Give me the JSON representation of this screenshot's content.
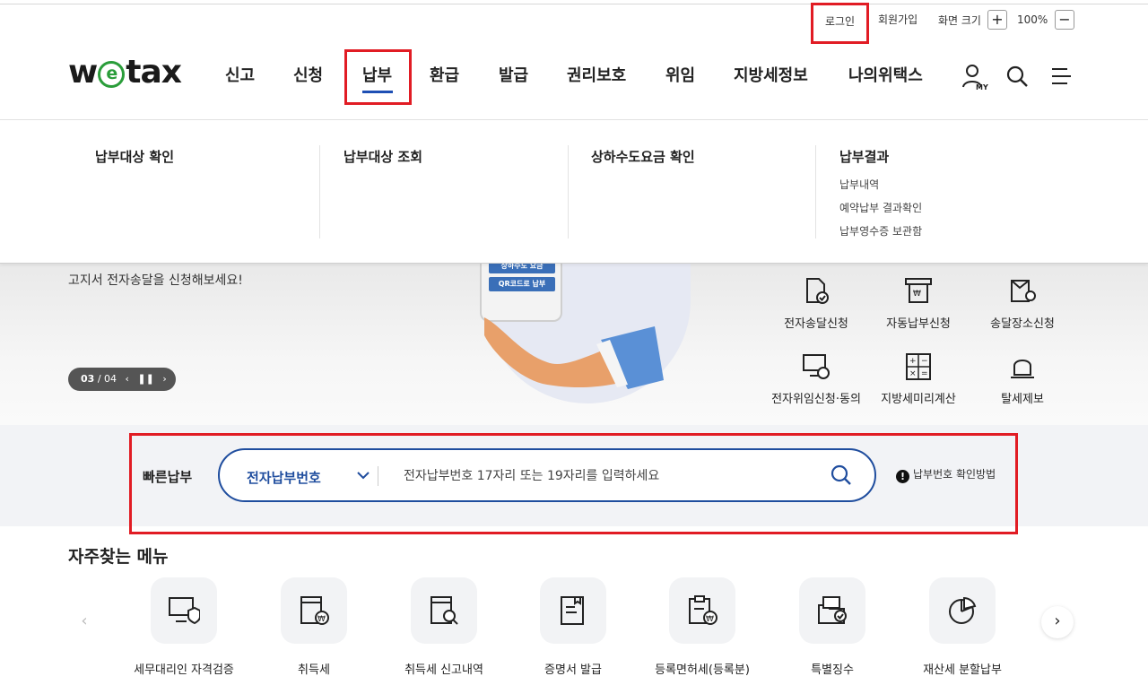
{
  "utility": {
    "login": "로그인",
    "join": "회원가입",
    "zoom_label": "화면 크기",
    "zoom_in": "+",
    "zoom_value": "100%",
    "zoom_out": "−"
  },
  "logo": {
    "w": "w",
    "e": "e",
    "tax": "tax"
  },
  "nav": {
    "items": [
      "신고",
      "신청",
      "납부",
      "환급",
      "발급",
      "권리보호",
      "위임",
      "지방세정보",
      "나의위택스"
    ],
    "active": "납부",
    "my_label": "MY"
  },
  "mega": {
    "cols": [
      {
        "title": "납부대상 확인",
        "links": []
      },
      {
        "title": "납부대상 조회",
        "links": []
      },
      {
        "title": "상하수도요금 확인",
        "links": []
      },
      {
        "title": "납부결과",
        "links": [
          "납부내역",
          "예약납부 결과확인",
          "납부영수증 보관함"
        ]
      }
    ]
  },
  "banner": {
    "copy": "고지서 전자송달을 신청해보세요!",
    "pager_current": "03",
    "pager_total": "/ 04",
    "phone_buttons": [
      "상하수도 요금",
      "QR코드로 납부"
    ]
  },
  "quick": [
    {
      "label": "전자송달신청",
      "icon": "document-check-icon"
    },
    {
      "label": "자동납부신청",
      "icon": "auto-payment-icon"
    },
    {
      "label": "송달장소신청",
      "icon": "location-document-icon"
    },
    {
      "label": "전자위임신청·동의",
      "icon": "monitor-lock-icon"
    },
    {
      "label": "지방세미리계산",
      "icon": "calculator-icon"
    },
    {
      "label": "탈세제보",
      "icon": "siren-icon"
    }
  ],
  "fast_pay": {
    "title": "빠른납부",
    "select_value": "전자납부번호",
    "placeholder": "전자납부번호 17자리 또는 19자리를 입력하세요",
    "help": "납부번호 확인방법",
    "help_mark": "!"
  },
  "frequent": {
    "title": "자주찾는 메뉴",
    "prev": "‹",
    "next": "›",
    "items": [
      {
        "label": "세무대리인 자격검증",
        "icon": "monitor-shield-icon"
      },
      {
        "label": "취득세",
        "icon": "document-won-icon"
      },
      {
        "label": "취득세 신고내역",
        "icon": "document-search-icon"
      },
      {
        "label": "증명서 발급",
        "icon": "certificate-icon"
      },
      {
        "label": "등록면허세(등록분)",
        "icon": "clipboard-won-icon"
      },
      {
        "label": "특별징수",
        "icon": "folder-check-icon"
      },
      {
        "label": "재산세 분할납부",
        "icon": "pie-chart-icon"
      }
    ]
  },
  "colors": {
    "accent": "#1f4d9e",
    "highlight": "#e11c24",
    "logo_green": "#2a9d3a"
  }
}
